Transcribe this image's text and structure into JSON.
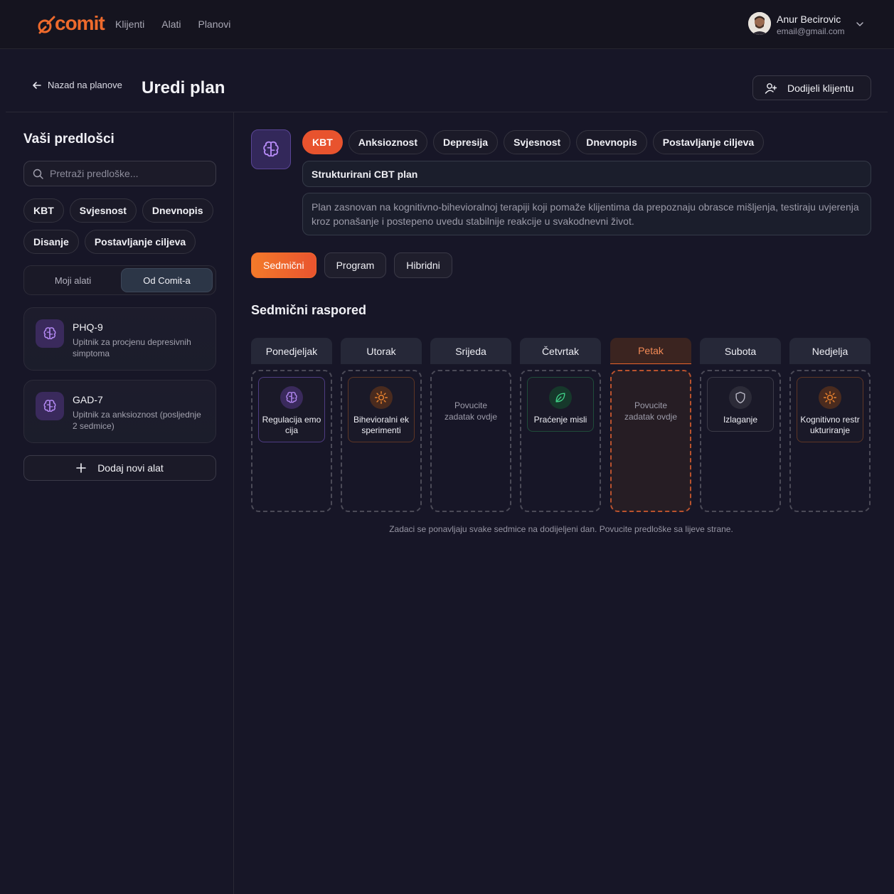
{
  "app": {
    "logo_text": "comit",
    "brand_color": "#ee6a2c"
  },
  "nav": {
    "items": [
      {
        "label": "Klijenti"
      },
      {
        "label": "Alati"
      },
      {
        "label": "Planovi"
      }
    ]
  },
  "user": {
    "name": "Anur Becirovic",
    "email": "email@gmail.com"
  },
  "header": {
    "back_label": "Nazad na planove",
    "title": "Uredi plan",
    "assign_label": "Dodijeli klijentu"
  },
  "sidebar": {
    "title": "Vaši predlošci",
    "search_placeholder": "Pretraži predloške...",
    "tags": [
      "KBT",
      "Svjesnost",
      "Dnevnopis",
      "Disanje",
      "Postavljanje ciljeva"
    ],
    "toggle": {
      "options": [
        "Moji alati",
        "Od Comit-a"
      ],
      "selected": "Od Comit-a"
    },
    "tools": [
      {
        "name": "PHQ-9",
        "description": "Upitnik za procjenu depresivnih simptoma",
        "icon": "brain-icon"
      },
      {
        "name": "GAD-7",
        "description": "Upitnik za anksioznost (posljednje 2 sedmice)",
        "icon": "brain-icon"
      }
    ],
    "add_tool_label": "Dodaj novi alat"
  },
  "plan": {
    "icon": "brain-icon",
    "categories": [
      {
        "label": "KBT",
        "active": true
      },
      {
        "label": "Anksioznost",
        "active": false
      },
      {
        "label": "Depresija",
        "active": false
      },
      {
        "label": "Svjesnost",
        "active": false
      },
      {
        "label": "Dnevnopis",
        "active": false
      },
      {
        "label": "Postavljanje ciljeva",
        "active": false
      }
    ],
    "name": "Strukturirani CBT plan",
    "description": "Plan zasnovan na kognitivno-bihevioralnoj terapiji koji pomaže klijentima da prepoznaju obrasce mišljenja, testiraju uvjerenja kroz ponašanje i postepeno uvedu stabilnije reakcije u svakodnevni život."
  },
  "modes": {
    "options": [
      "Sedmični",
      "Program",
      "Hibridni"
    ],
    "selected": "Sedmični"
  },
  "schedule": {
    "title": "Sedmični raspored",
    "drop_hint": "Povucite zadatak ovdje",
    "days": [
      {
        "name": "Ponedjeljak",
        "task": {
          "label": "Regulacija emocija",
          "icon": "brain-icon",
          "color": "purple"
        }
      },
      {
        "name": "Utorak",
        "task": {
          "label": "Bihevioralni eksperimenti",
          "icon": "sun-icon",
          "color": "orange"
        }
      },
      {
        "name": "Srijeda",
        "task": null
      },
      {
        "name": "Četvrtak",
        "task": {
          "label": "Praćenje misli",
          "icon": "leaf-icon",
          "color": "green"
        }
      },
      {
        "name": "Petak",
        "task": null,
        "active": true
      },
      {
        "name": "Subota",
        "task": {
          "label": "Izlaganje",
          "icon": "shield-icon",
          "color": "gray"
        }
      },
      {
        "name": "Nedjelja",
        "task": {
          "label": "Kognitivno restrukturiranje",
          "icon": "sun-icon",
          "color": "orange"
        }
      }
    ],
    "footnote": "Zadaci se ponavljaju svake sedmice na dodijeljeni dan. Povucite predloške sa lijeve strane."
  },
  "colors": {
    "accent": "#e8532e",
    "purple": "#a77bf0",
    "orange": "#f0862f",
    "green": "#3fcf86"
  }
}
